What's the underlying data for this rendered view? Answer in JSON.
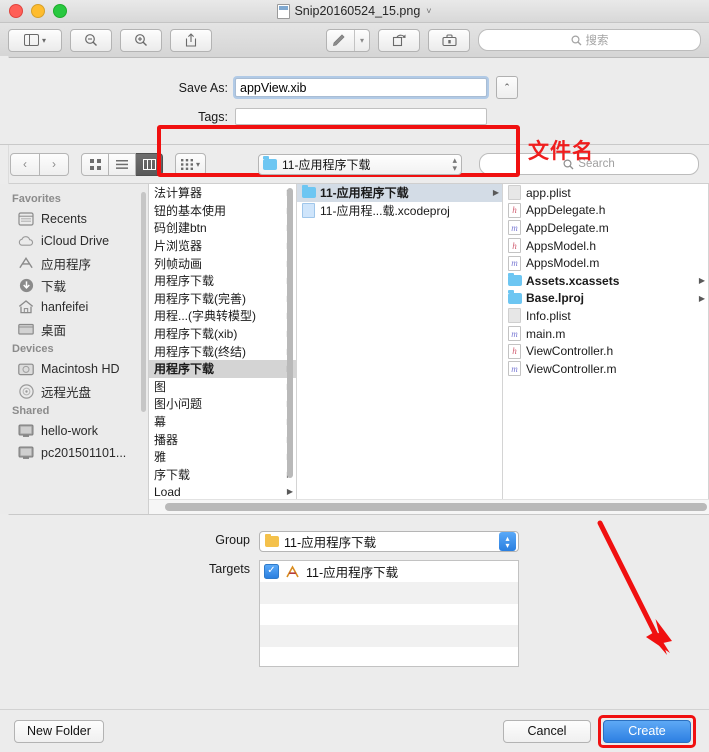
{
  "window": {
    "title": "Snip20160524_15.png",
    "title_chevron": "˅",
    "traffic": {
      "close": "close-button",
      "minimize": "minimize-button",
      "zoom": "zoom-button"
    }
  },
  "preview_toolbar": {
    "sidebar_label": "",
    "zoom_out": "zoom-out-icon",
    "zoom_in": "zoom-in-icon",
    "share": "share-icon",
    "markup": "markup-icon",
    "rotate": "rotate-icon",
    "toolkit": "toolkit-icon",
    "search_placeholder": "搜索"
  },
  "save_panel": {
    "save_as_label": "Save As:",
    "filename_value": "appView.xib",
    "stepper_glyph": "⌃",
    "tags_label": "Tags:",
    "tags_value": "",
    "annotation": "文件名",
    "annotation_color": "#ef1d1d"
  },
  "browser_toolbar": {
    "back": "‹",
    "forward": "›",
    "view_icon": "icon-view",
    "view_list": "list-view",
    "view_column": "column-view",
    "arrange": "arrange-icon",
    "path_label": "11-应用程序下载",
    "search_placeholder": "Search"
  },
  "sidebar": {
    "sections": [
      {
        "header": "Favorites",
        "items": [
          {
            "label": "Recents",
            "icon": "recents-icon"
          },
          {
            "label": "iCloud Drive",
            "icon": "cloud-icon"
          },
          {
            "label": "应用程序",
            "icon": "applications-icon"
          },
          {
            "label": "下载",
            "icon": "downloads-icon"
          },
          {
            "label": "hanfeifei",
            "icon": "home-icon"
          },
          {
            "label": "桌面",
            "icon": "desktop-icon"
          }
        ]
      },
      {
        "header": "Devices",
        "items": [
          {
            "label": "Macintosh HD",
            "icon": "harddisk-icon"
          },
          {
            "label": "远程光盘",
            "icon": "disc-icon"
          }
        ]
      },
      {
        "header": "Shared",
        "items": [
          {
            "label": "hello-work",
            "icon": "computer-icon"
          },
          {
            "label": "pc201501101...",
            "icon": "computer-icon"
          }
        ]
      }
    ]
  },
  "column1": {
    "rows": [
      {
        "label": "法计算器",
        "arrow": true,
        "selected": false
      },
      {
        "label": "钮的基本使用",
        "arrow": true,
        "selected": false
      },
      {
        "label": "码创建btn",
        "arrow": true,
        "selected": false
      },
      {
        "label": "片浏览器",
        "arrow": true,
        "selected": false
      },
      {
        "label": "列帧动画",
        "arrow": true,
        "selected": false
      },
      {
        "label": "用程序下载",
        "arrow": true,
        "selected": false
      },
      {
        "label": "用程序下载(完善)",
        "arrow": true,
        "selected": false
      },
      {
        "label": "用程...(字典转模型)",
        "arrow": true,
        "selected": false
      },
      {
        "label": "用程序下载(xib)",
        "arrow": true,
        "selected": false
      },
      {
        "label": "用程序下载(终结)",
        "arrow": true,
        "selected": false
      },
      {
        "label": "用程序下载",
        "arrow": true,
        "selected": true
      },
      {
        "label": "图",
        "arrow": true,
        "selected": false
      },
      {
        "label": "图小问题",
        "arrow": true,
        "selected": false
      },
      {
        "label": "幕",
        "arrow": true,
        "selected": false
      },
      {
        "label": "播器",
        "arrow": true,
        "selected": false
      },
      {
        "label": "雅",
        "arrow": true,
        "selected": false
      },
      {
        "label": "序下载",
        "arrow": true,
        "selected": false
      },
      {
        "label": "Load",
        "arrow": true,
        "selected": false
      }
    ]
  },
  "column2": {
    "rows": [
      {
        "label": "11-应用程序下载",
        "icon": "folder-blue",
        "arrow": true,
        "selected": true
      },
      {
        "label": "11-应用程...载.xcodeproj",
        "icon": "xcodeproj",
        "arrow": false,
        "selected": false
      }
    ]
  },
  "column3": {
    "rows": [
      {
        "label": "app.plist",
        "icon": "plist",
        "arrow": false,
        "bold": false
      },
      {
        "label": "AppDelegate.h",
        "icon": "h",
        "arrow": false,
        "bold": false
      },
      {
        "label": "AppDelegate.m",
        "icon": "m",
        "arrow": false,
        "bold": false
      },
      {
        "label": "AppsModel.h",
        "icon": "h",
        "arrow": false,
        "bold": false
      },
      {
        "label": "AppsModel.m",
        "icon": "m",
        "arrow": false,
        "bold": false
      },
      {
        "label": "Assets.xcassets",
        "icon": "folder-blue",
        "arrow": true,
        "bold": true
      },
      {
        "label": "Base.lproj",
        "icon": "folder-blue",
        "arrow": true,
        "bold": true
      },
      {
        "label": "Info.plist",
        "icon": "plist",
        "arrow": false,
        "bold": false
      },
      {
        "label": "main.m",
        "icon": "m",
        "arrow": false,
        "bold": false
      },
      {
        "label": "ViewController.h",
        "icon": "h",
        "arrow": false,
        "bold": false
      },
      {
        "label": "ViewController.m",
        "icon": "m",
        "arrow": false,
        "bold": false
      }
    ]
  },
  "options": {
    "group_label": "Group",
    "group_value": "11-应用程序下载",
    "targets_label": "Targets",
    "targets": [
      {
        "label": "11-应用程序下载",
        "checked": true
      }
    ]
  },
  "bottom_bar": {
    "new_folder_label": "New Folder",
    "cancel_label": "Cancel",
    "create_label": "Create"
  },
  "annotations": {
    "highlight_color": "#f01010",
    "arrow": "red-arrow-pointing-to-create"
  }
}
